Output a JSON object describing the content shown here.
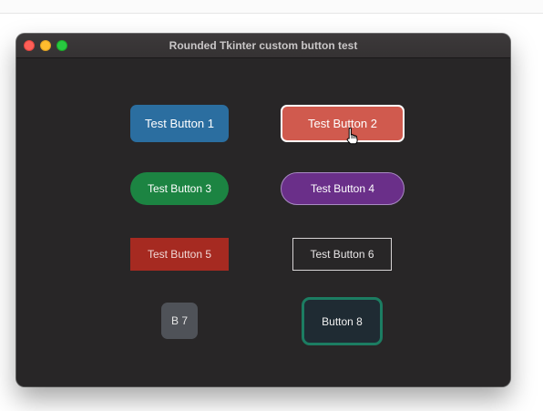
{
  "window": {
    "title": "Rounded Tkinter custom button test"
  },
  "buttons": [
    {
      "label": "Test Button 1",
      "color": "#2b6ea0"
    },
    {
      "label": "Test Button 2",
      "color": "#d05a4e"
    },
    {
      "label": "Test Button 3",
      "color": "#1c8442"
    },
    {
      "label": "Test Button 4",
      "color": "#6a2f89"
    },
    {
      "label": "Test Button 5",
      "color": "#a62a21"
    },
    {
      "label": "Test Button 6",
      "color": "transparent"
    },
    {
      "label": "B 7",
      "color": "#4f5258"
    },
    {
      "label": "Button 8",
      "color": "#1f2b33"
    }
  ],
  "cursor": {
    "icon": "hand-pointer-icon"
  },
  "traffic_lights": {
    "close_color": "#fe5f57",
    "minimize_color": "#febc2e",
    "maximize_color": "#28c840"
  }
}
